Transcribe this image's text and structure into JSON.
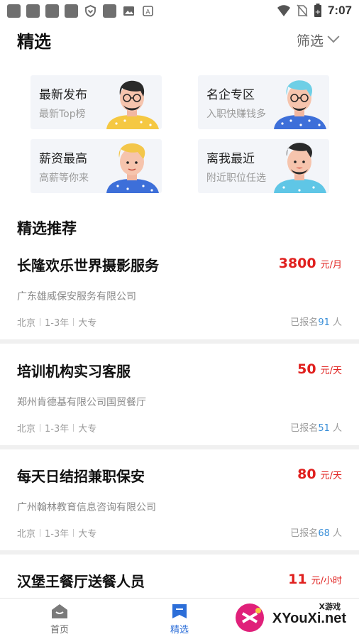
{
  "status_bar": {
    "time": "7:07"
  },
  "header": {
    "title": "精选",
    "filter_label": "筛选"
  },
  "categories": [
    {
      "title": "最新发布",
      "subtitle": "最新Top榜",
      "shirt_color": "#f5c842",
      "hair_color": "#2a2a2a",
      "avatar_icon": "man-glasses-avatar-icon"
    },
    {
      "title": "名企专区",
      "subtitle": "入职快赚钱多",
      "shirt_color": "#3d6fd9",
      "hair_color": "#6ecfe6",
      "avatar_icon": "man-cyan-hair-avatar-icon"
    },
    {
      "title": "薪资最高",
      "subtitle": "高薪等你来",
      "shirt_color": "#3d6fd9",
      "hair_color": "#f3c64a",
      "avatar_icon": "man-blond-avatar-icon"
    },
    {
      "title": "离我最近",
      "subtitle": "附近职位任选",
      "shirt_color": "#5fc6e6",
      "hair_color": "#2a2a2a",
      "avatar_icon": "man-dark-hair-avatar-icon"
    }
  ],
  "section": {
    "title": "精选推荐"
  },
  "jobs": [
    {
      "title": "长隆欢乐世界摄影服务",
      "salary": "3800",
      "unit": "元/月",
      "company": "广东雄威保安服务有限公司",
      "city": "北京",
      "experience": "1-3年",
      "education": "大专",
      "enroll_prefix": "已报名",
      "enroll_count": "91",
      "enroll_suffix": " 人"
    },
    {
      "title": "培训机构实习客服",
      "salary": "50",
      "unit": "元/天",
      "company": "郑州肯德基有限公司国贸餐厅",
      "city": "北京",
      "experience": "1-3年",
      "education": "大专",
      "enroll_prefix": "已报名",
      "enroll_count": "51",
      "enroll_suffix": " 人"
    },
    {
      "title": "每天日结招兼职保安",
      "salary": "80",
      "unit": "元/天",
      "company": "广州翰林教育信息咨询有限公司",
      "city": "北京",
      "experience": "1-3年",
      "education": "大专",
      "enroll_prefix": "已报名",
      "enroll_count": "68",
      "enroll_suffix": " 人"
    },
    {
      "title": "汉堡王餐厅送餐人员",
      "salary": "11",
      "unit": "元/小时"
    }
  ],
  "bottom_nav": {
    "items": [
      {
        "label": "首页",
        "icon": "home-icon",
        "active": false
      },
      {
        "label": "精选",
        "icon": "bookmark-icon",
        "active": true
      }
    ]
  },
  "watermark": {
    "top": "X游戏",
    "text": "XYouXi.net"
  },
  "colors": {
    "accent_blue": "#2c6ed8",
    "salary_red": "#e0201e",
    "card_bg": "#f3f5f9"
  }
}
